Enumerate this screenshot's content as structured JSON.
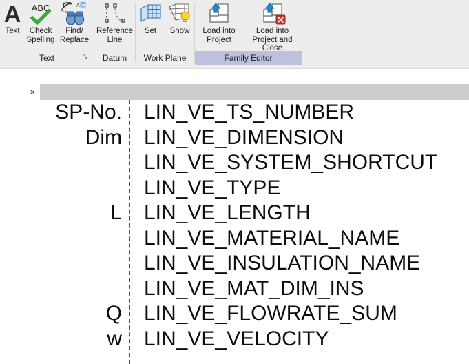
{
  "ribbon": {
    "panels": [
      {
        "name": "Text",
        "label": "Text",
        "has_dialog_launcher": true,
        "buttons": [
          {
            "name": "text",
            "label": "Text",
            "icon": "letter-a-icon"
          },
          {
            "name": "check-spelling",
            "label": "Check\nSpelling",
            "icon": "abc-checkmark-icon"
          },
          {
            "name": "find-replace",
            "label": "Find/\nReplace",
            "icon": "binoculars-icon"
          }
        ]
      },
      {
        "name": "Datum",
        "label": "Datum",
        "has_dialog_launcher": false,
        "buttons": [
          {
            "name": "reference-line",
            "label": "Reference\nLine",
            "icon": "reference-line-icon"
          }
        ]
      },
      {
        "name": "Work Plane",
        "label": "Work Plane",
        "has_dialog_launcher": false,
        "buttons": [
          {
            "name": "set",
            "label": "Set",
            "icon": "work-plane-set-icon"
          },
          {
            "name": "show",
            "label": "Show",
            "icon": "work-plane-show-icon"
          }
        ]
      },
      {
        "name": "Family Editor",
        "label": "Family Editor",
        "highlighted": true,
        "has_dialog_launcher": false,
        "buttons": [
          {
            "name": "load-into-project",
            "label": "Load into\nProject",
            "icon": "load-into-project-icon"
          },
          {
            "name": "load-into-project-and-close",
            "label": "Load into\nProject and Close",
            "icon": "load-into-project-close-icon"
          }
        ]
      }
    ]
  },
  "tabstrip": {
    "close_label": "×"
  },
  "canvas": {
    "reference_line_color": "#0a7a14",
    "rows": [
      {
        "symbol": "SP-No.",
        "parameter": "LIN_VE_TS_NUMBER"
      },
      {
        "symbol": "Dim",
        "parameter": "LIN_VE_DIMENSION"
      },
      {
        "symbol": "",
        "parameter": "LIN_VE_SYSTEM_SHORTCUT"
      },
      {
        "symbol": "",
        "parameter": "LIN_VE_TYPE"
      },
      {
        "symbol": "L",
        "parameter": "LIN_VE_LENGTH"
      },
      {
        "symbol": "",
        "parameter": "LIN_VE_MATERIAL_NAME"
      },
      {
        "symbol": "",
        "parameter": "LIN_VE_INSULATION_NAME"
      },
      {
        "symbol": "",
        "parameter": "LIN_VE_MAT_DIM_INS"
      },
      {
        "symbol": "Q",
        "parameter": "LIN_VE_FLOWRATE_SUM"
      },
      {
        "symbol": "w",
        "parameter": "LIN_VE_VELOCITY"
      }
    ]
  }
}
